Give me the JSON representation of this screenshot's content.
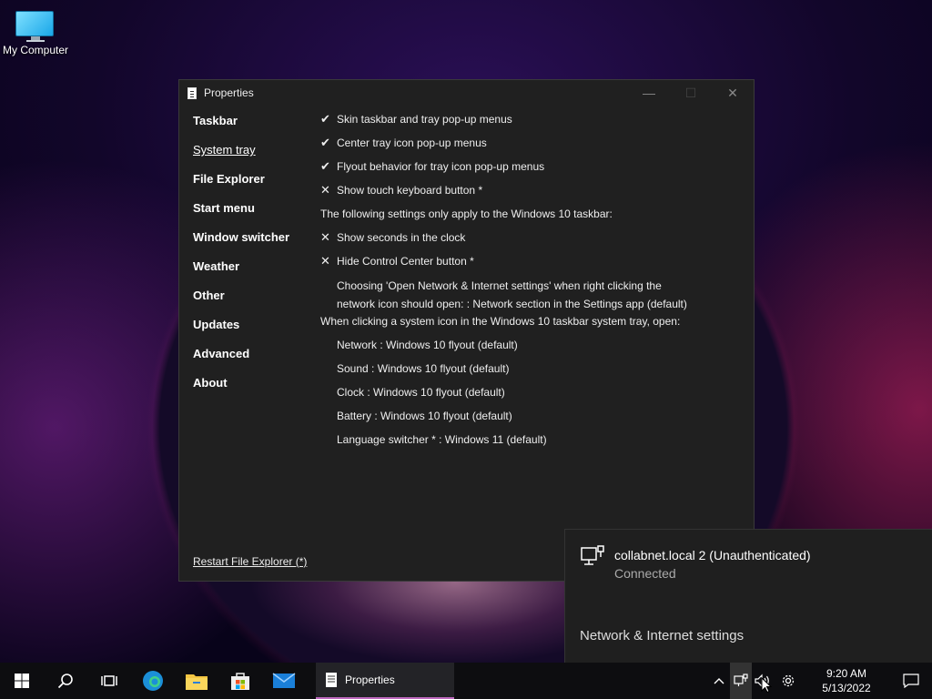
{
  "desktop": {
    "icons": [
      {
        "label": "My Computer",
        "icon": "computer-icon"
      }
    ]
  },
  "window": {
    "title": "Properties",
    "controls": {
      "minimize": "—",
      "maximize": "☐",
      "close": "✕"
    },
    "nav": [
      {
        "label": "Taskbar",
        "active": false
      },
      {
        "label": "System tray",
        "active": true
      },
      {
        "label": "File Explorer",
        "active": false
      },
      {
        "label": "Start menu",
        "active": false
      },
      {
        "label": "Window switcher",
        "active": false
      },
      {
        "label": "Weather",
        "active": false
      },
      {
        "label": "Other",
        "active": false
      },
      {
        "label": "Updates",
        "active": false
      },
      {
        "label": "Advanced",
        "active": false
      },
      {
        "label": "About",
        "active": false
      }
    ],
    "settings": [
      {
        "mark": "✔",
        "text": "Skin taskbar and tray pop-up menus"
      },
      {
        "mark": "✔",
        "text": "Center tray icon pop-up menus"
      },
      {
        "mark": "✔",
        "text": "Flyout behavior for tray icon pop-up menus"
      },
      {
        "mark": "✕",
        "text": "Show touch keyboard button *"
      },
      {
        "mark": "",
        "text": "The following settings only apply to the Windows 10 taskbar:"
      },
      {
        "mark": "✕",
        "text": "Show seconds in the clock"
      },
      {
        "mark": "✕",
        "text": "Hide Control Center button *"
      },
      {
        "mark": "",
        "text": "Choosing 'Open Network & Internet settings' when right clicking the",
        "text2": "network icon should open: : Network section in the Settings app (default)"
      },
      {
        "mark": "",
        "text": "When clicking a system icon in the Windows 10 taskbar system tray, open:"
      },
      {
        "mark": "",
        "text": "Network : Windows 10 flyout (default)"
      },
      {
        "mark": "",
        "text": "Sound : Windows 10 flyout (default)"
      },
      {
        "mark": "",
        "text": "Clock : Windows 10 flyout (default)"
      },
      {
        "mark": "",
        "text": "Battery : Windows 10 flyout (default)"
      },
      {
        "mark": "",
        "text": "Language switcher * : Windows 11 (default)"
      }
    ],
    "restart_link": "Restart File Explorer (*)"
  },
  "network_flyout": {
    "name": "collabnet.local 2 (Unauthenticated)",
    "status": "Connected",
    "settings_link": "Network & Internet settings"
  },
  "taskbar": {
    "start_icon": "windows-logo-icon",
    "pinned": [
      "search-icon",
      "task-view-icon",
      "edge-icon",
      "file-explorer-icon",
      "store-icon",
      "mail-icon"
    ],
    "running_app": {
      "label": "Properties",
      "icon": "properties-icon"
    },
    "tray": {
      "time": "9:20 AM",
      "date": "5/13/2022"
    },
    "accent": "#c06ac0"
  }
}
